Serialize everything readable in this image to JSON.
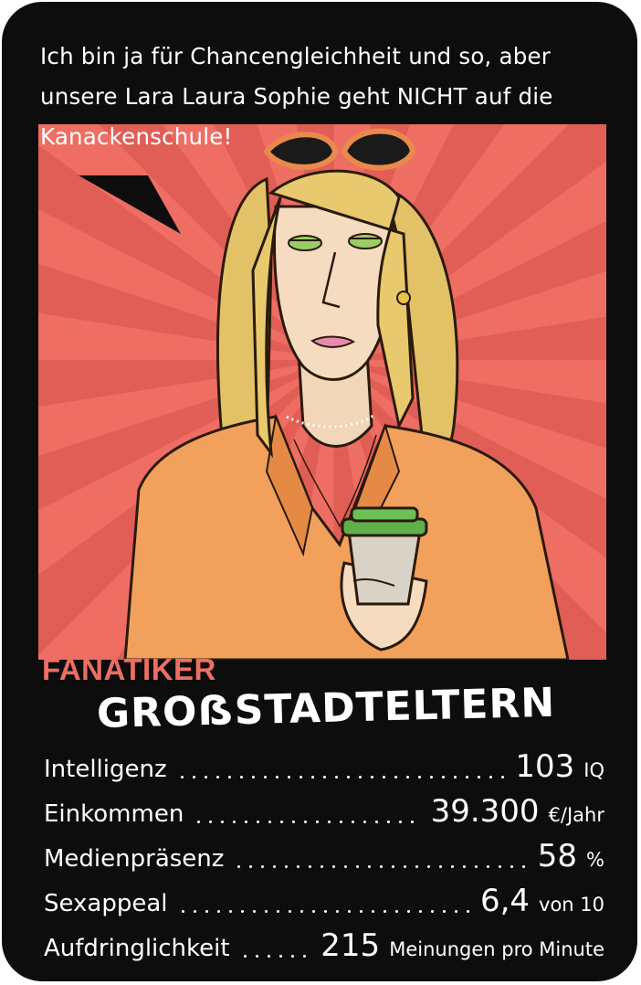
{
  "card": {
    "quote_lines": [
      "Ich bin ja für Chancengleichheit und so, aber",
      "unsere Lara Laura Sophie geht NICHT auf die",
      "Kanackenschule!"
    ],
    "category": "FANATIKER",
    "title": "GROẞSTADTELTERN",
    "colors": {
      "card_bg": "#0d0d0d",
      "panel_bg": "#ee6e63",
      "category": "#ee6e63",
      "text": "#ffffff"
    },
    "stats": [
      {
        "label": "Intelligenz",
        "value": "103",
        "unit": "IQ"
      },
      {
        "label": "Einkommen",
        "value": "39.300",
        "unit": "€/Jahr"
      },
      {
        "label": "Medienpräsenz",
        "value": "58",
        "unit": "%"
      },
      {
        "label": "Sexappeal",
        "value": "6,4",
        "unit": "von 10"
      },
      {
        "label": "Aufdringlichkeit",
        "value": "215",
        "unit": "Meinungen pro Minute"
      }
    ]
  }
}
